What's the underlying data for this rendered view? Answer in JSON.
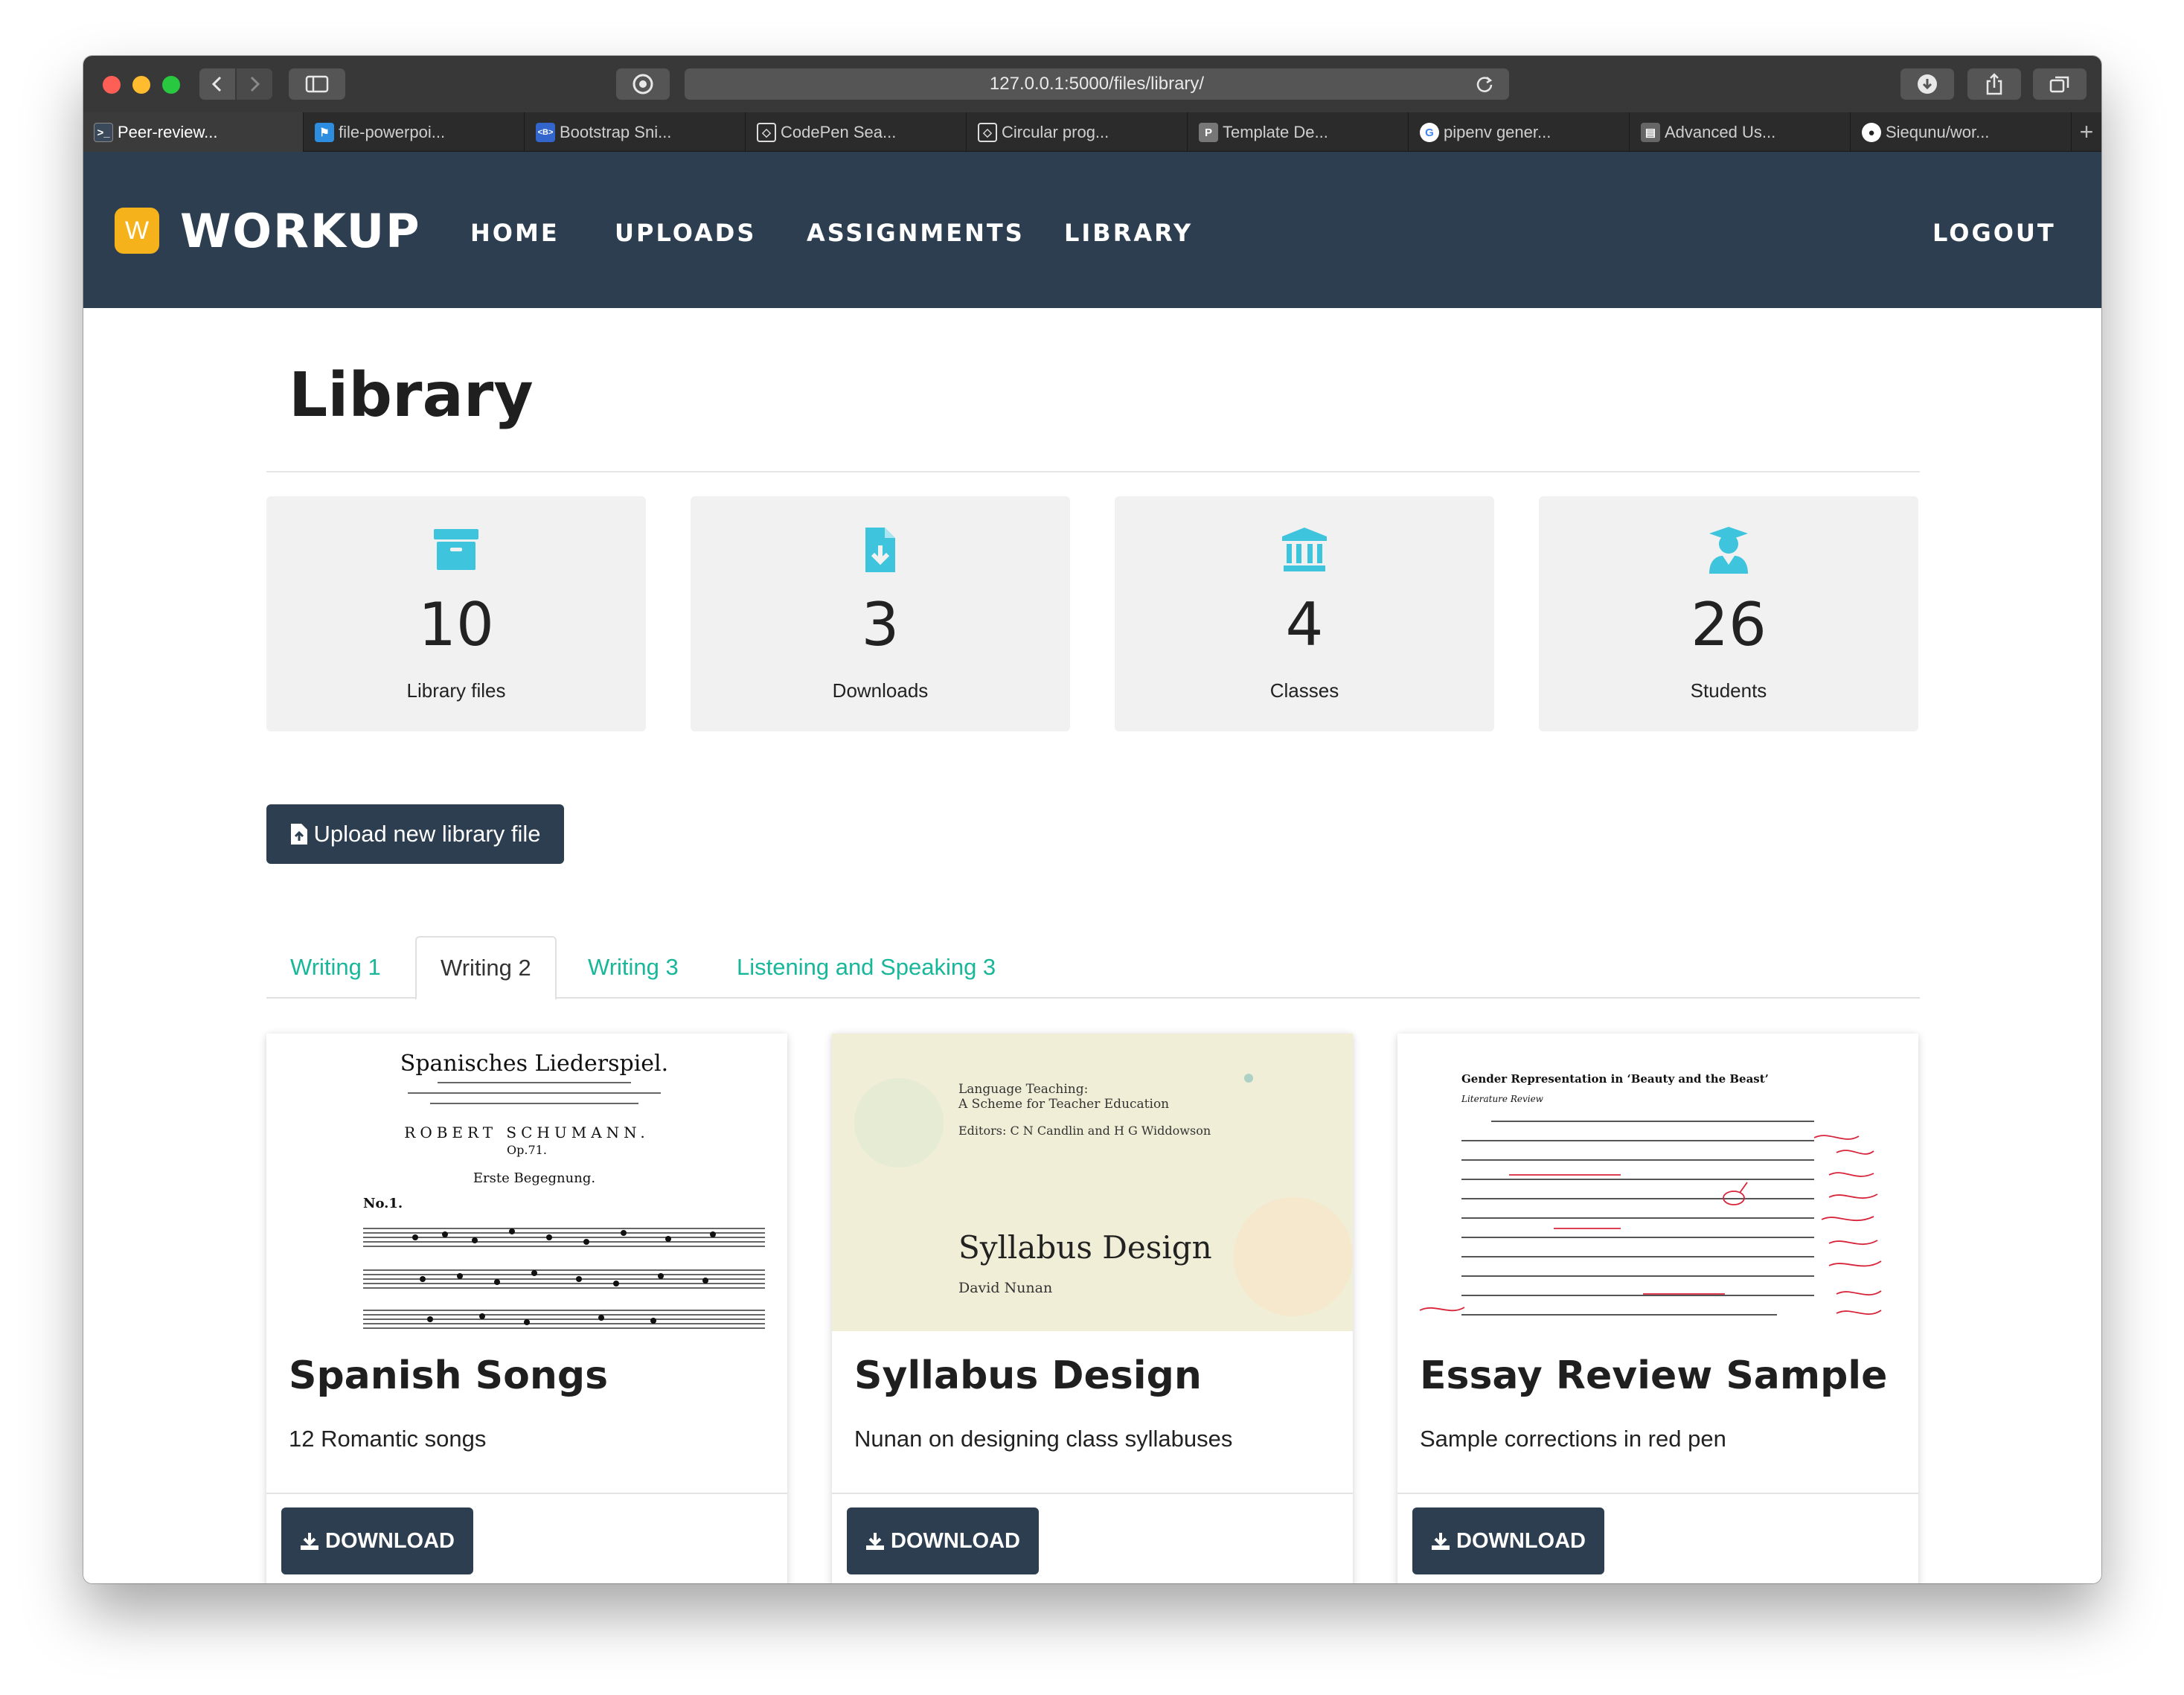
{
  "browser": {
    "url": "127.0.0.1:5000/files/library/",
    "tabs": [
      {
        "label": "Peer-review...",
        "icon": "terminal-icon",
        "color": "#3a4a5a"
      },
      {
        "label": "file-powerpoi...",
        "icon": "flag-icon",
        "color": "#2d8ee0"
      },
      {
        "label": "Bootstrap Sni...",
        "icon": "bootstrap-icon",
        "color": "#3366cc"
      },
      {
        "label": "CodePen Sea...",
        "icon": "codepen-icon",
        "color": "#444444"
      },
      {
        "label": "Circular prog...",
        "icon": "codepen-icon",
        "color": "#444444"
      },
      {
        "label": "Template De...",
        "icon": "p-icon",
        "color": "#777777"
      },
      {
        "label": "pipenv gener...",
        "icon": "google-icon",
        "color": "#ffffff"
      },
      {
        "label": "Advanced Us...",
        "icon": "doc-icon",
        "color": "#666666"
      },
      {
        "label": "Siequnu/wor...",
        "icon": "github-icon",
        "color": "#ffffff"
      }
    ]
  },
  "nav": {
    "logo_letter": "W",
    "brand": "WORKUP",
    "links": [
      "HOME",
      "UPLOADS",
      "ASSIGNMENTS",
      "LIBRARY"
    ],
    "logout": "LOGOUT"
  },
  "page": {
    "title": "Library",
    "stats": [
      {
        "value": "10",
        "label": "Library files",
        "icon": "archive-icon"
      },
      {
        "value": "3",
        "label": "Downloads",
        "icon": "file-download-icon"
      },
      {
        "value": "4",
        "label": "Classes",
        "icon": "university-icon"
      },
      {
        "value": "26",
        "label": "Students",
        "icon": "user-graduate-icon"
      }
    ],
    "upload_button": "Upload new library file",
    "tabs": [
      "Writing 1",
      "Writing 2",
      "Writing 3",
      "Listening and Speaking 3"
    ],
    "active_tab": "Writing 2",
    "accent_color": "#18b79a",
    "cards": [
      {
        "title": "Spanish Songs",
        "description": "12 Romantic songs",
        "button": "DOWNLOAD",
        "thumb": {
          "heading": "Spanisches Liederspiel.",
          "composer": "ROBERT SCHUMANN.",
          "opus": "Op.71.",
          "sub": "Erste Begegnung.",
          "no": "No.1."
        }
      },
      {
        "title": "Syllabus Design",
        "description": "Nunan on designing class syllabuses",
        "button": "DOWNLOAD",
        "thumb": {
          "series": "Language Teaching:",
          "series2": "A Scheme for Teacher Education",
          "editors": "Editors: C N Candlin and H G Widdowson",
          "book": "Syllabus Design",
          "author": "David Nunan"
        }
      },
      {
        "title": "Essay Review Sample",
        "description": "Sample corrections in red pen",
        "button": "DOWNLOAD",
        "thumb": {
          "heading": "Gender Representation in ‘Beauty and the Beast’",
          "sub": "Literature Review"
        }
      }
    ]
  },
  "colors": {
    "nav_bg": "#2d3e50",
    "icon_cyan": "#3ec4dc",
    "brand_yellow": "#f6b21a"
  }
}
